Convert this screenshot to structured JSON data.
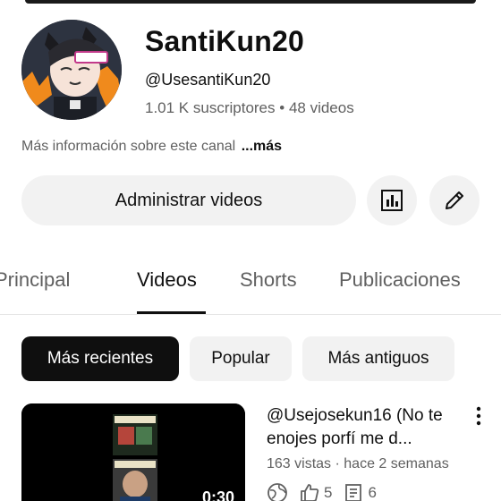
{
  "channel": {
    "name": "SantiKun20",
    "handle": "@UsesantiKun20",
    "subscribers": "1.01 K suscriptores",
    "separator": "•",
    "video_count": "48 videos",
    "about_text": "Más información sobre este canal",
    "about_more": "...más"
  },
  "actions": {
    "manage_label": "Administrar videos",
    "analytics_icon": "analytics-icon",
    "edit_icon": "pencil-icon"
  },
  "tabs": [
    {
      "label": "Principal",
      "active": false
    },
    {
      "label": "Videos",
      "active": true
    },
    {
      "label": "Shorts",
      "active": false
    },
    {
      "label": "Publicaciones",
      "active": false
    }
  ],
  "filters": [
    {
      "label": "Más recientes",
      "active": true
    },
    {
      "label": "Popular",
      "active": false
    },
    {
      "label": "Más antiguos",
      "active": false
    }
  ],
  "videos": [
    {
      "title": "@Usejosekun16 (No te enojes porfí me d...",
      "views": "163 vistas",
      "age": "hace 2 semanas",
      "duration": "0:30",
      "likes": "5",
      "comments": "6"
    }
  ],
  "colors": {
    "text_primary": "#0f0f0f",
    "text_secondary": "#606060",
    "chip_bg": "#f2f2f2",
    "chip_active_bg": "#0f0f0f"
  }
}
